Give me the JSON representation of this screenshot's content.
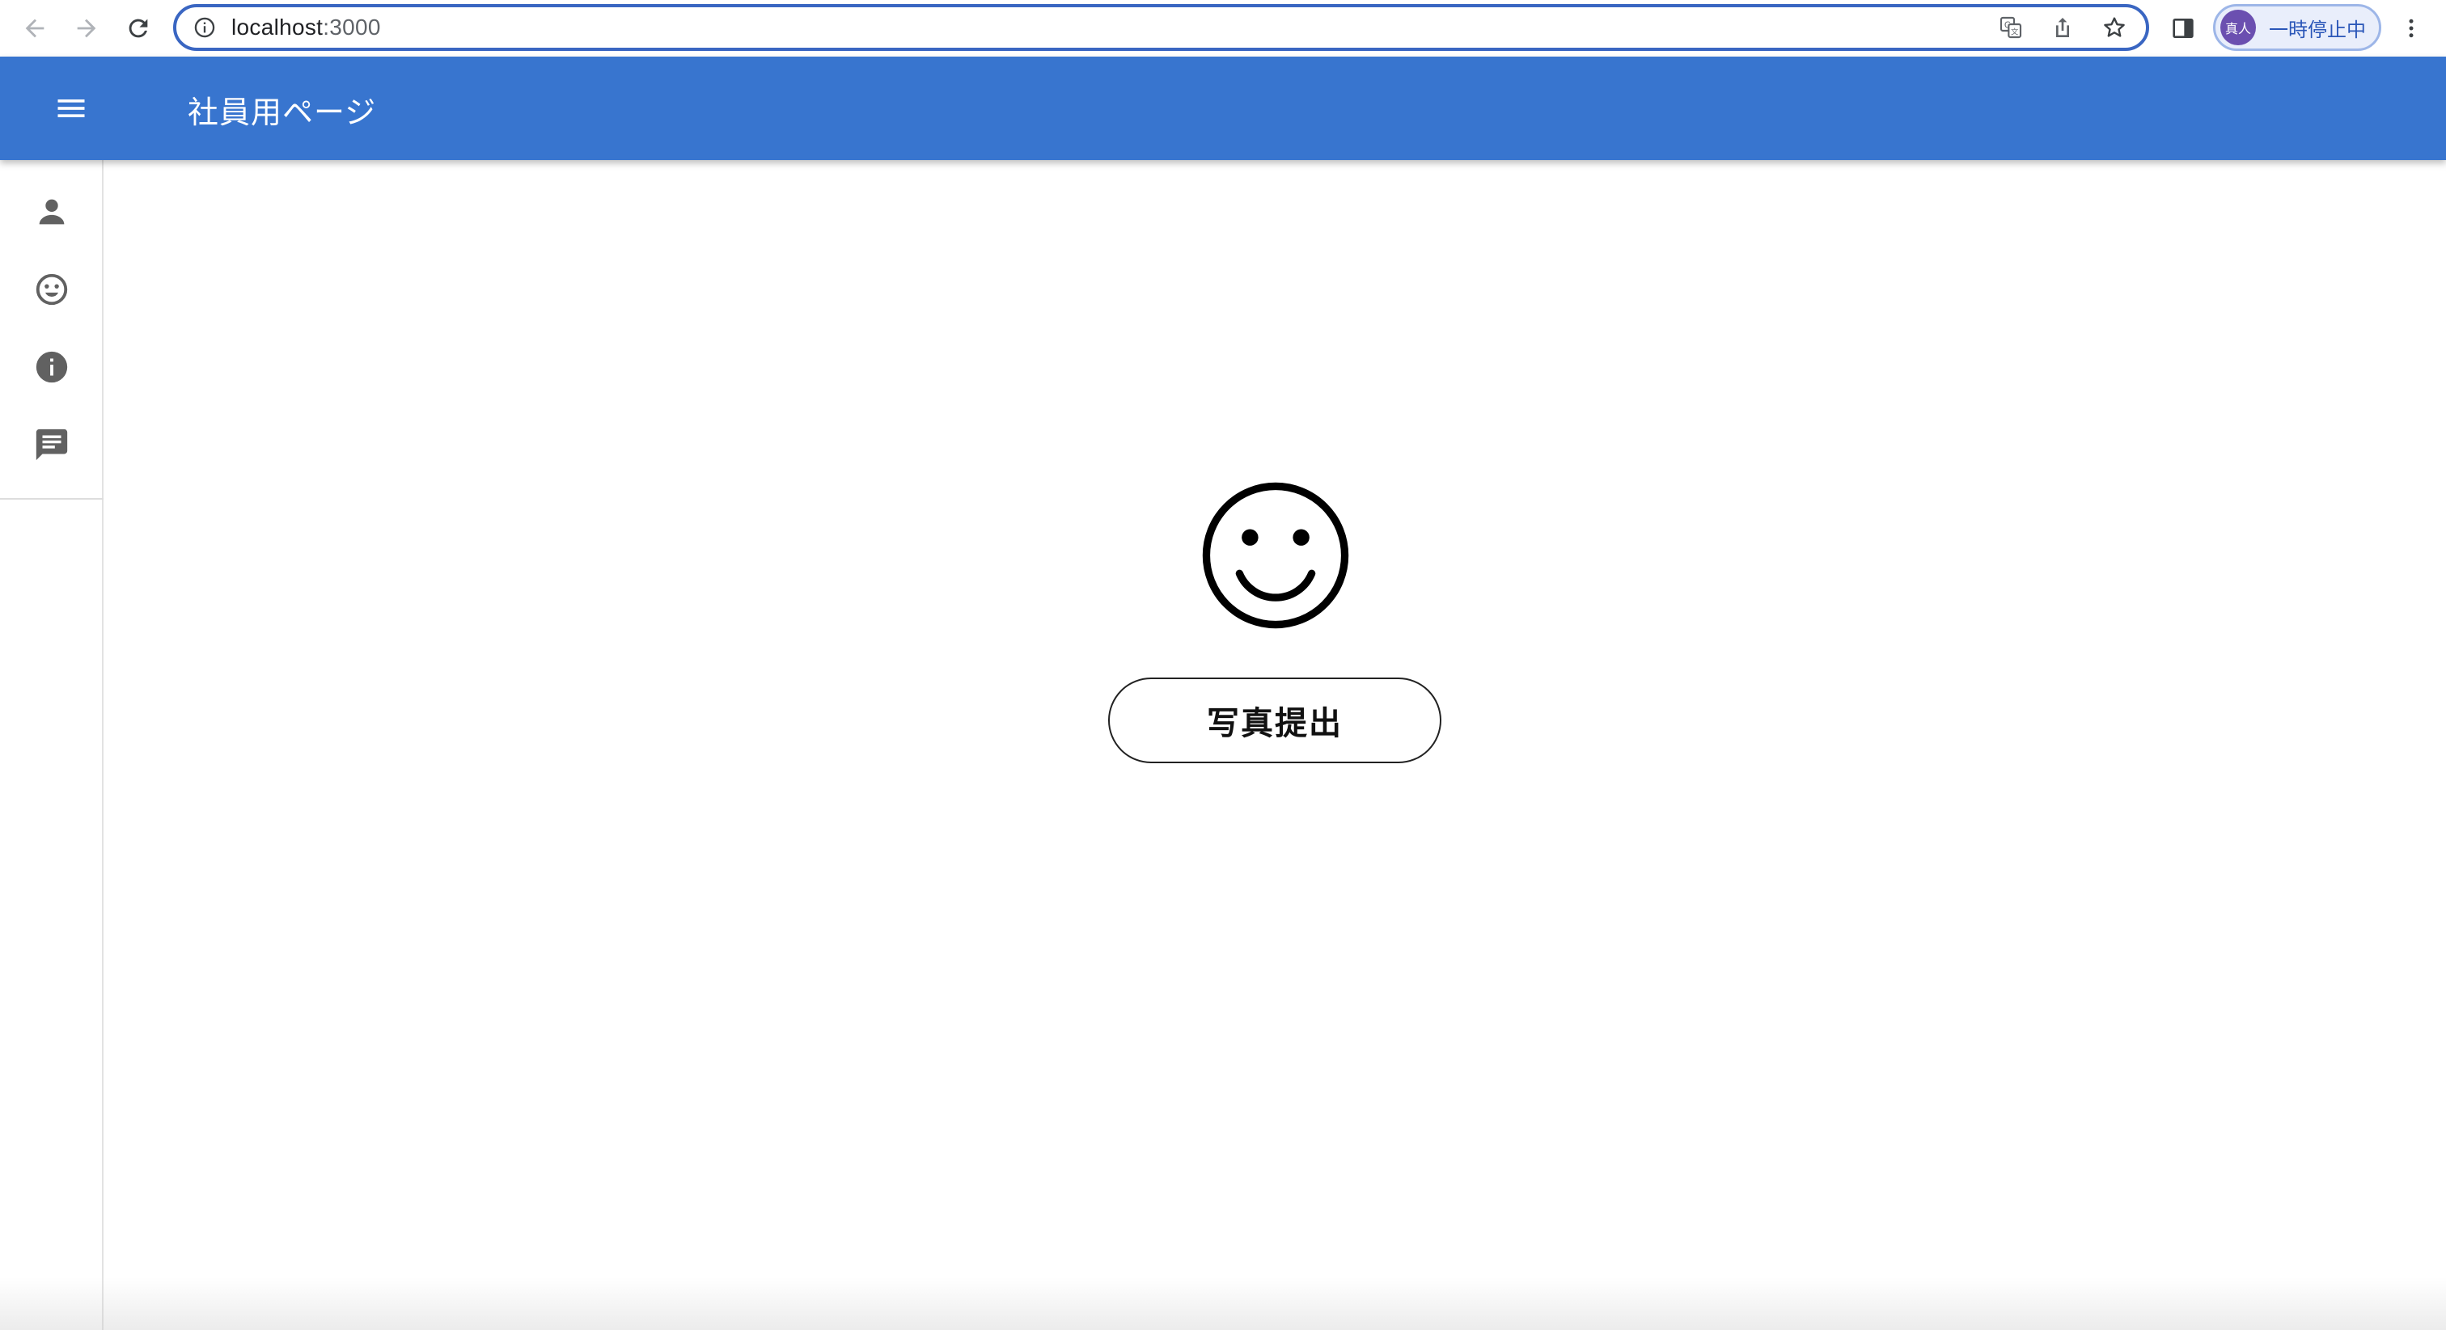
{
  "browser": {
    "url_host": "localhost",
    "url_port": ":3000",
    "profile_avatar_text": "真人",
    "profile_status": "一時停止中"
  },
  "app_bar": {
    "title": "社員用ページ"
  },
  "side_rail": {
    "items": [
      {
        "icon": "person-icon"
      },
      {
        "icon": "smiley-icon"
      },
      {
        "icon": "info-icon"
      },
      {
        "icon": "chat-icon"
      }
    ]
  },
  "main": {
    "face_icon": "smiley-face-icon",
    "submit_label": "写真提出"
  },
  "colors": {
    "app_bar": "#3875cf",
    "omnibox_border": "#3a66c2",
    "profile_chip_bg": "#e9eefb",
    "avatar_bg": "#6b4fb0"
  }
}
